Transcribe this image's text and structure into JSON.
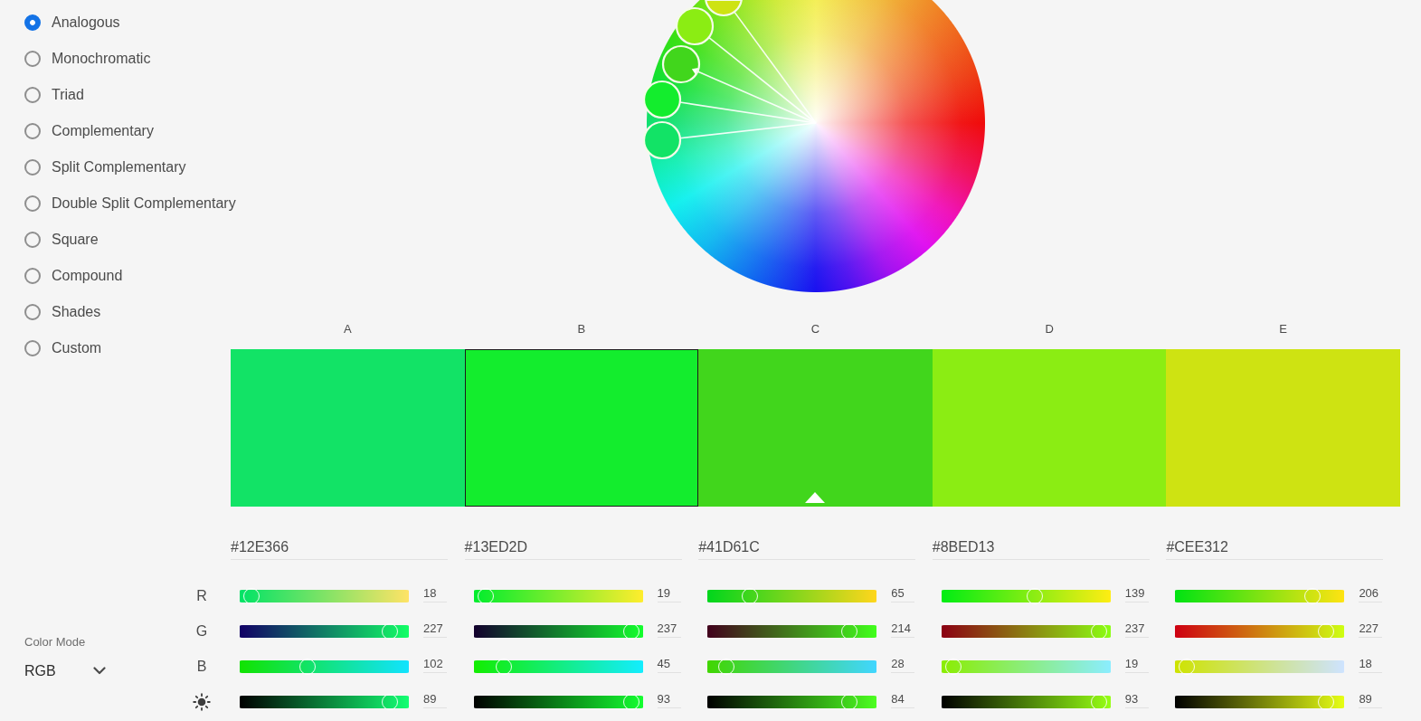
{
  "harmony_rules": [
    {
      "label": "Analogous",
      "selected": true
    },
    {
      "label": "Monochromatic",
      "selected": false
    },
    {
      "label": "Triad",
      "selected": false
    },
    {
      "label": "Complementary",
      "selected": false
    },
    {
      "label": "Split Complementary",
      "selected": false
    },
    {
      "label": "Double Split Complementary",
      "selected": false
    },
    {
      "label": "Square",
      "selected": false
    },
    {
      "label": "Compound",
      "selected": false
    },
    {
      "label": "Shades",
      "selected": false
    },
    {
      "label": "Custom",
      "selected": false
    }
  ],
  "swatches": [
    {
      "label": "A",
      "color": "#12e366",
      "hex": "#12E366",
      "selected": false,
      "base": false,
      "sliders": [
        {
          "level": 0.07,
          "value": "18"
        },
        {
          "level": 0.89,
          "value": "227"
        },
        {
          "level": 0.4,
          "value": "102"
        },
        {
          "level": 0.89,
          "value": "89"
        }
      ]
    },
    {
      "label": "B",
      "color": "#13ed2d",
      "hex": "#13ED2D",
      "selected": true,
      "base": false,
      "sliders": [
        {
          "level": 0.07,
          "value": "19"
        },
        {
          "level": 0.93,
          "value": "237"
        },
        {
          "level": 0.18,
          "value": "45"
        },
        {
          "level": 0.93,
          "value": "93"
        }
      ]
    },
    {
      "label": "C",
      "color": "#41d61c",
      "hex": "#41D61C",
      "selected": false,
      "base": true,
      "sliders": [
        {
          "level": 0.25,
          "value": "65"
        },
        {
          "level": 0.84,
          "value": "214"
        },
        {
          "level": 0.11,
          "value": "28"
        },
        {
          "level": 0.84,
          "value": "84"
        }
      ]
    },
    {
      "label": "D",
      "color": "#8bed13",
      "hex": "#8BED13",
      "selected": false,
      "base": false,
      "sliders": [
        {
          "level": 0.55,
          "value": "139"
        },
        {
          "level": 0.93,
          "value": "237"
        },
        {
          "level": 0.07,
          "value": "19"
        },
        {
          "level": 0.93,
          "value": "93"
        }
      ]
    },
    {
      "label": "E",
      "color": "#cee312",
      "hex": "#CEE312",
      "selected": false,
      "base": false,
      "sliders": [
        {
          "level": 0.81,
          "value": "206"
        },
        {
          "level": 0.89,
          "value": "227"
        },
        {
          "level": 0.07,
          "value": "18"
        },
        {
          "level": 0.89,
          "value": "89"
        }
      ]
    }
  ],
  "channels": [
    {
      "kind": "red",
      "label": "R"
    },
    {
      "kind": "green",
      "label": "G"
    },
    {
      "kind": "blue",
      "label": "B"
    },
    {
      "kind": "brightness"
    }
  ],
  "color_mode": {
    "label": "Color Mode",
    "value": "RGB"
  }
}
